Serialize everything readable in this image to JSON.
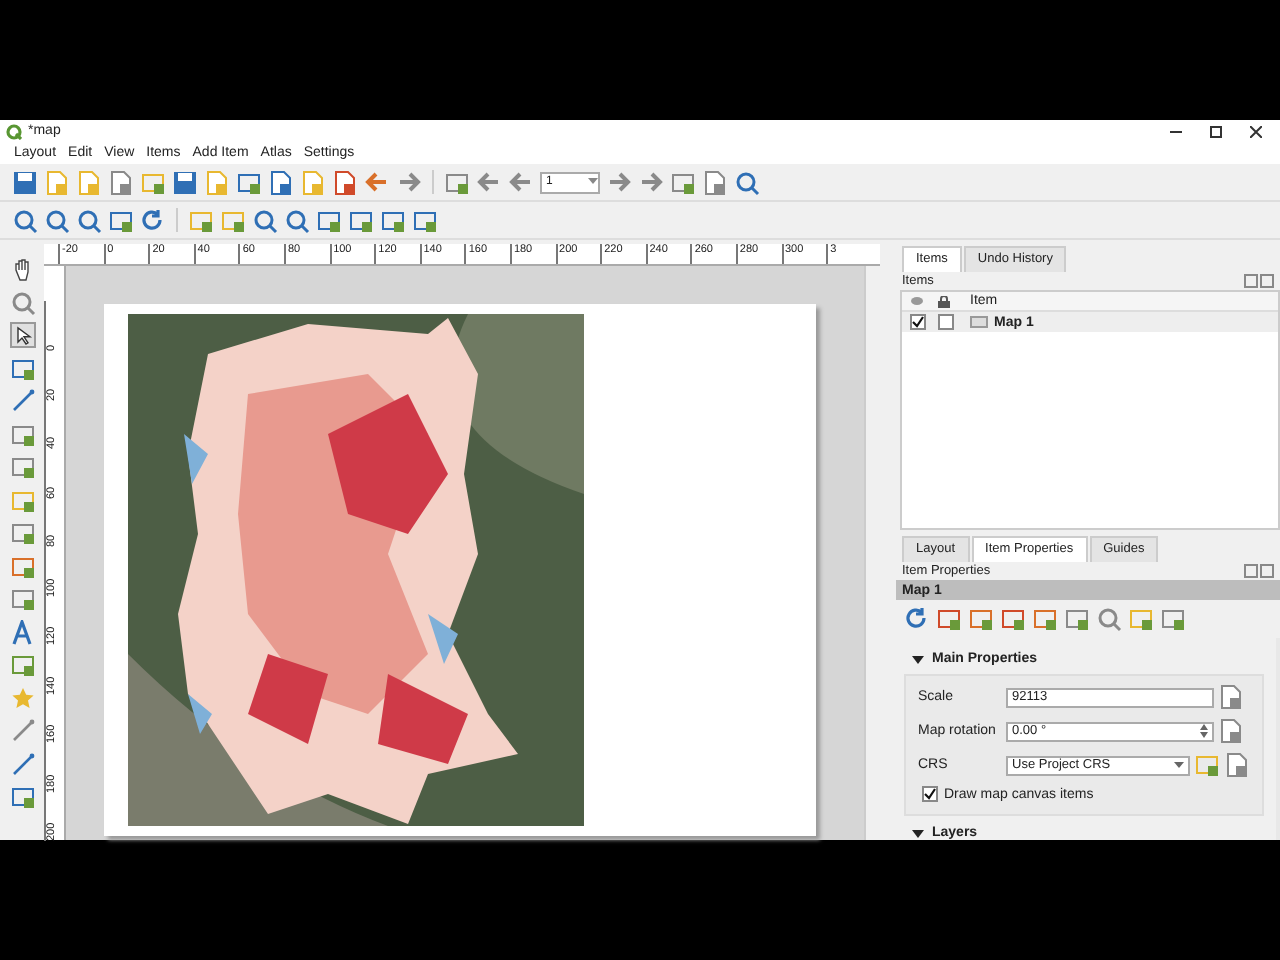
{
  "window": {
    "title": "*map"
  },
  "menu": [
    "Layout",
    "Edit",
    "View",
    "Items",
    "Add Item",
    "Atlas",
    "Settings"
  ],
  "toolbar": {
    "page_number": "1"
  },
  "rulers": {
    "horizontal": [
      "-20",
      "0",
      "20",
      "40",
      "60",
      "80",
      "100",
      "120",
      "140",
      "160",
      "180",
      "200",
      "220",
      "240",
      "260",
      "280",
      "300",
      "3"
    ],
    "vertical": [
      "0",
      "20",
      "40",
      "60",
      "80",
      "100",
      "120",
      "140",
      "160",
      "180",
      "200"
    ]
  },
  "items_panel": {
    "tabs": [
      {
        "label": "Items",
        "selected": true
      },
      {
        "label": "Undo History",
        "selected": false
      }
    ],
    "title": "Items",
    "column": "Item",
    "rows": [
      {
        "name": "Map 1",
        "visible": true,
        "locked": false
      }
    ]
  },
  "properties_panel": {
    "tabs": [
      {
        "label": "Layout",
        "selected": false
      },
      {
        "label": "Item Properties",
        "selected": true
      },
      {
        "label": "Guides",
        "selected": false
      }
    ],
    "title": "Item Properties",
    "item_name": "Map 1",
    "sections": [
      {
        "title": "Main Properties",
        "expanded": true,
        "fields": [
          {
            "label": "Scale",
            "value": "92113",
            "kind": "text"
          },
          {
            "label": "Map rotation",
            "value": "0.00 °",
            "kind": "spin"
          },
          {
            "label": "CRS",
            "value": "Use Project CRS",
            "kind": "combo"
          }
        ],
        "checkbox": {
          "label": "Draw map canvas items",
          "checked": true
        }
      },
      {
        "title": "Layers",
        "expanded": true
      }
    ]
  }
}
